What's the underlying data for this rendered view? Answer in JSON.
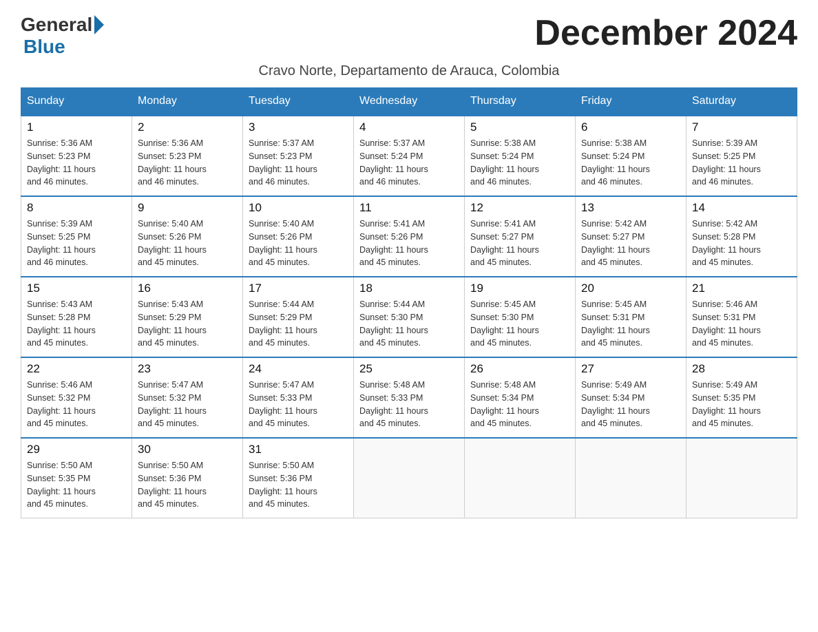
{
  "header": {
    "logo_general": "General",
    "logo_blue": "Blue",
    "month_title": "December 2024",
    "subtitle": "Cravo Norte, Departamento de Arauca, Colombia"
  },
  "weekdays": [
    "Sunday",
    "Monday",
    "Tuesday",
    "Wednesday",
    "Thursday",
    "Friday",
    "Saturday"
  ],
  "weeks": [
    [
      {
        "day": "1",
        "sunrise": "5:36 AM",
        "sunset": "5:23 PM",
        "daylight": "11 hours and 46 minutes."
      },
      {
        "day": "2",
        "sunrise": "5:36 AM",
        "sunset": "5:23 PM",
        "daylight": "11 hours and 46 minutes."
      },
      {
        "day": "3",
        "sunrise": "5:37 AM",
        "sunset": "5:23 PM",
        "daylight": "11 hours and 46 minutes."
      },
      {
        "day": "4",
        "sunrise": "5:37 AM",
        "sunset": "5:24 PM",
        "daylight": "11 hours and 46 minutes."
      },
      {
        "day": "5",
        "sunrise": "5:38 AM",
        "sunset": "5:24 PM",
        "daylight": "11 hours and 46 minutes."
      },
      {
        "day": "6",
        "sunrise": "5:38 AM",
        "sunset": "5:24 PM",
        "daylight": "11 hours and 46 minutes."
      },
      {
        "day": "7",
        "sunrise": "5:39 AM",
        "sunset": "5:25 PM",
        "daylight": "11 hours and 46 minutes."
      }
    ],
    [
      {
        "day": "8",
        "sunrise": "5:39 AM",
        "sunset": "5:25 PM",
        "daylight": "11 hours and 46 minutes."
      },
      {
        "day": "9",
        "sunrise": "5:40 AM",
        "sunset": "5:26 PM",
        "daylight": "11 hours and 45 minutes."
      },
      {
        "day": "10",
        "sunrise": "5:40 AM",
        "sunset": "5:26 PM",
        "daylight": "11 hours and 45 minutes."
      },
      {
        "day": "11",
        "sunrise": "5:41 AM",
        "sunset": "5:26 PM",
        "daylight": "11 hours and 45 minutes."
      },
      {
        "day": "12",
        "sunrise": "5:41 AM",
        "sunset": "5:27 PM",
        "daylight": "11 hours and 45 minutes."
      },
      {
        "day": "13",
        "sunrise": "5:42 AM",
        "sunset": "5:27 PM",
        "daylight": "11 hours and 45 minutes."
      },
      {
        "day": "14",
        "sunrise": "5:42 AM",
        "sunset": "5:28 PM",
        "daylight": "11 hours and 45 minutes."
      }
    ],
    [
      {
        "day": "15",
        "sunrise": "5:43 AM",
        "sunset": "5:28 PM",
        "daylight": "11 hours and 45 minutes."
      },
      {
        "day": "16",
        "sunrise": "5:43 AM",
        "sunset": "5:29 PM",
        "daylight": "11 hours and 45 minutes."
      },
      {
        "day": "17",
        "sunrise": "5:44 AM",
        "sunset": "5:29 PM",
        "daylight": "11 hours and 45 minutes."
      },
      {
        "day": "18",
        "sunrise": "5:44 AM",
        "sunset": "5:30 PM",
        "daylight": "11 hours and 45 minutes."
      },
      {
        "day": "19",
        "sunrise": "5:45 AM",
        "sunset": "5:30 PM",
        "daylight": "11 hours and 45 minutes."
      },
      {
        "day": "20",
        "sunrise": "5:45 AM",
        "sunset": "5:31 PM",
        "daylight": "11 hours and 45 minutes."
      },
      {
        "day": "21",
        "sunrise": "5:46 AM",
        "sunset": "5:31 PM",
        "daylight": "11 hours and 45 minutes."
      }
    ],
    [
      {
        "day": "22",
        "sunrise": "5:46 AM",
        "sunset": "5:32 PM",
        "daylight": "11 hours and 45 minutes."
      },
      {
        "day": "23",
        "sunrise": "5:47 AM",
        "sunset": "5:32 PM",
        "daylight": "11 hours and 45 minutes."
      },
      {
        "day": "24",
        "sunrise": "5:47 AM",
        "sunset": "5:33 PM",
        "daylight": "11 hours and 45 minutes."
      },
      {
        "day": "25",
        "sunrise": "5:48 AM",
        "sunset": "5:33 PM",
        "daylight": "11 hours and 45 minutes."
      },
      {
        "day": "26",
        "sunrise": "5:48 AM",
        "sunset": "5:34 PM",
        "daylight": "11 hours and 45 minutes."
      },
      {
        "day": "27",
        "sunrise": "5:49 AM",
        "sunset": "5:34 PM",
        "daylight": "11 hours and 45 minutes."
      },
      {
        "day": "28",
        "sunrise": "5:49 AM",
        "sunset": "5:35 PM",
        "daylight": "11 hours and 45 minutes."
      }
    ],
    [
      {
        "day": "29",
        "sunrise": "5:50 AM",
        "sunset": "5:35 PM",
        "daylight": "11 hours and 45 minutes."
      },
      {
        "day": "30",
        "sunrise": "5:50 AM",
        "sunset": "5:36 PM",
        "daylight": "11 hours and 45 minutes."
      },
      {
        "day": "31",
        "sunrise": "5:50 AM",
        "sunset": "5:36 PM",
        "daylight": "11 hours and 45 minutes."
      },
      null,
      null,
      null,
      null
    ]
  ],
  "labels": {
    "sunrise": "Sunrise:",
    "sunset": "Sunset:",
    "daylight": "Daylight:"
  }
}
